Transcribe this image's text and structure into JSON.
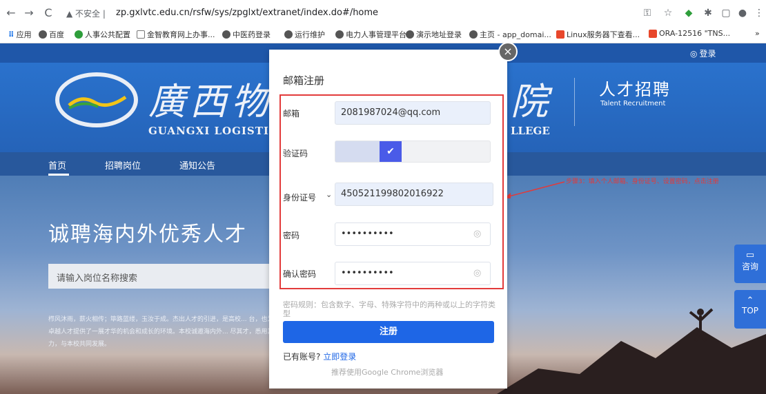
{
  "browser": {
    "back": "←",
    "forward": "→",
    "reload": "C",
    "insecure_label": "▲ 不安全 |",
    "url": "zp.gxlvtc.edu.cn/rsfw/sys/zpglxt/extranet/index.do#/home",
    "toolbar_icons": [
      "key-icon",
      "star-icon",
      "extension-icon",
      "puzzle-icon",
      "sidepanel-icon",
      "profile-icon",
      "menu-icon"
    ]
  },
  "bookmarks": {
    "apps": "应用",
    "items": [
      "百度",
      "人事公共配置",
      "金智教育网上办事...",
      "中医药登录",
      "运行维护",
      "电力人事管理平台",
      "演示地址登录",
      "主页 - app_domai...",
      "Linux服务器下查看...",
      "ORA-12516 \"TNS..."
    ],
    "more": "»"
  },
  "site": {
    "login_top": "登录",
    "logo_title_left": "廣西物",
    "logo_title_right": "院",
    "logo_en_left": "GUANGXI LOGISTI",
    "logo_en_right": "LLEGE",
    "recruit_title": "人才招聘",
    "recruit_sub": "Talent Recruitment",
    "nav": [
      "首页",
      "招聘岗位",
      "通知公告"
    ],
    "hero_title": "诚聘海内外优秀人才",
    "search_placeholder": "请输入岗位名称搜索",
    "hero_desc": "栉风沐雨，薪火相传；筚路蓝缕，玉汝于成。杰出人才的引进，是高校... 台，也为卓越人才提供了一展才华的机会和成长的环境。本校诚邀海内外... 尽其才，悉用其力，与本校共同发展。",
    "side_consult": "咨询",
    "side_top": "TOP"
  },
  "modal": {
    "title": "邮箱注册",
    "close": "×",
    "email_label": "邮箱",
    "email_value": "2081987024@qq.com",
    "captcha_label": "验证码",
    "captcha_check": "✔",
    "id_type_label": "身份证号",
    "id_value": "450521199802016922",
    "password_label": "密码",
    "password_value": "••••••••••",
    "confirm_label": "确认密码",
    "confirm_value": "••••••••••",
    "password_rule": "密码规则：包含数字、字母、特殊字符中的两种或以上的字符类型",
    "register_button": "注册",
    "have_account": "已有账号?",
    "login_now": "立即登录",
    "recommend": "推荐使用Google Chrome浏览器"
  },
  "annotation": {
    "text": "步骤3：填入个人邮箱、身份证号、设置密码，点击注册"
  },
  "colors": {
    "primary": "#1e66e6",
    "annotation_red": "#e23a3a",
    "header_blue": "#2563b8"
  }
}
